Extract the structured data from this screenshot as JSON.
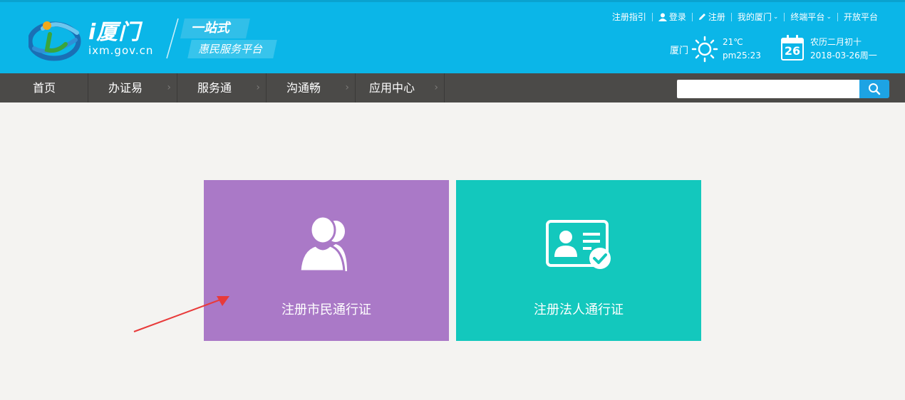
{
  "logo": {
    "title": "i厦门",
    "domain": "ixm.gov.cn",
    "slogan_line1": "一站式",
    "slogan_line2": "惠民服务平台"
  },
  "topnav": {
    "guide": "注册指引",
    "login": "登录",
    "register": "注册",
    "my_xiamen": "我的厦门",
    "terminal": "终端平台",
    "open_platform": "开放平台"
  },
  "weather": {
    "city": "厦门",
    "icon": "sun-icon",
    "temperature": "21℃",
    "time": "pm25:23"
  },
  "calendar": {
    "day": "26",
    "lunar": "农历二月初十",
    "date": "2018-03-26周一"
  },
  "nav": {
    "items": [
      {
        "label": "首页"
      },
      {
        "label": "办证易"
      },
      {
        "label": "服务通"
      },
      {
        "label": "沟通畅"
      },
      {
        "label": "应用中心"
      }
    ]
  },
  "search": {
    "value": "",
    "icon": "search-icon"
  },
  "cards": {
    "citizen": {
      "label": "注册市民通行证",
      "icon": "users-icon",
      "color": "#aa79c7"
    },
    "corporate": {
      "label": "注册法人通行证",
      "icon": "id-card-check-icon",
      "color": "#13c8bd"
    }
  },
  "colors": {
    "header_bg": "#0bb6e8",
    "nav_bg": "#4b4a48",
    "page_bg": "#f4f3f1",
    "annotation_arrow": "#e83a3a"
  }
}
